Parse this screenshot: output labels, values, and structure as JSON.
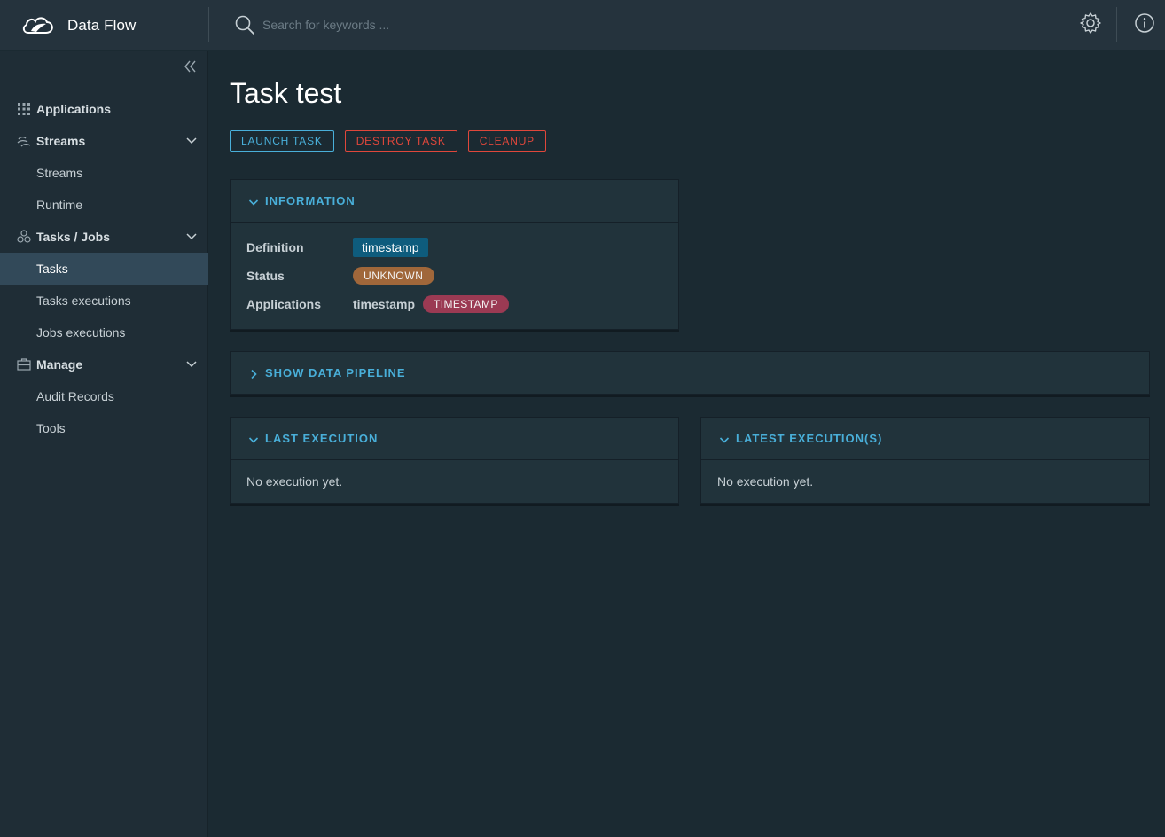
{
  "header": {
    "app_title": "Data Flow",
    "search_placeholder": "Search for keywords ..."
  },
  "sidebar": {
    "groups": [
      {
        "label": "Applications"
      },
      {
        "label": "Streams",
        "items": [
          "Streams",
          "Runtime"
        ]
      },
      {
        "label": "Tasks / Jobs",
        "items": [
          "Tasks",
          "Tasks executions",
          "Jobs executions"
        ]
      },
      {
        "label": "Manage",
        "items": [
          "Audit Records",
          "Tools"
        ]
      }
    ],
    "active_item": "Tasks"
  },
  "page": {
    "title": "Task test",
    "actions": {
      "launch": "LAUNCH TASK",
      "destroy": "DESTROY TASK",
      "cleanup": "CLEANUP"
    }
  },
  "information": {
    "title": "INFORMATION",
    "definition_label": "Definition",
    "definition_value": "timestamp",
    "status_label": "Status",
    "status_value": "UNKNOWN",
    "applications_label": "Applications",
    "application_name": "timestamp",
    "application_type": "TIMESTAMP"
  },
  "pipeline": {
    "title": "SHOW DATA PIPELINE"
  },
  "last_execution": {
    "title": "LAST EXECUTION",
    "empty": "No execution yet."
  },
  "latest_executions": {
    "title": "LATEST EXECUTION(S)",
    "empty": "No execution yet."
  },
  "colors": {
    "accent": "#49afd9",
    "danger": "#e0473b",
    "status_unknown": "#a0673a",
    "type_chip": "#9b3a53",
    "definition_chip": "#0e5c7d"
  }
}
